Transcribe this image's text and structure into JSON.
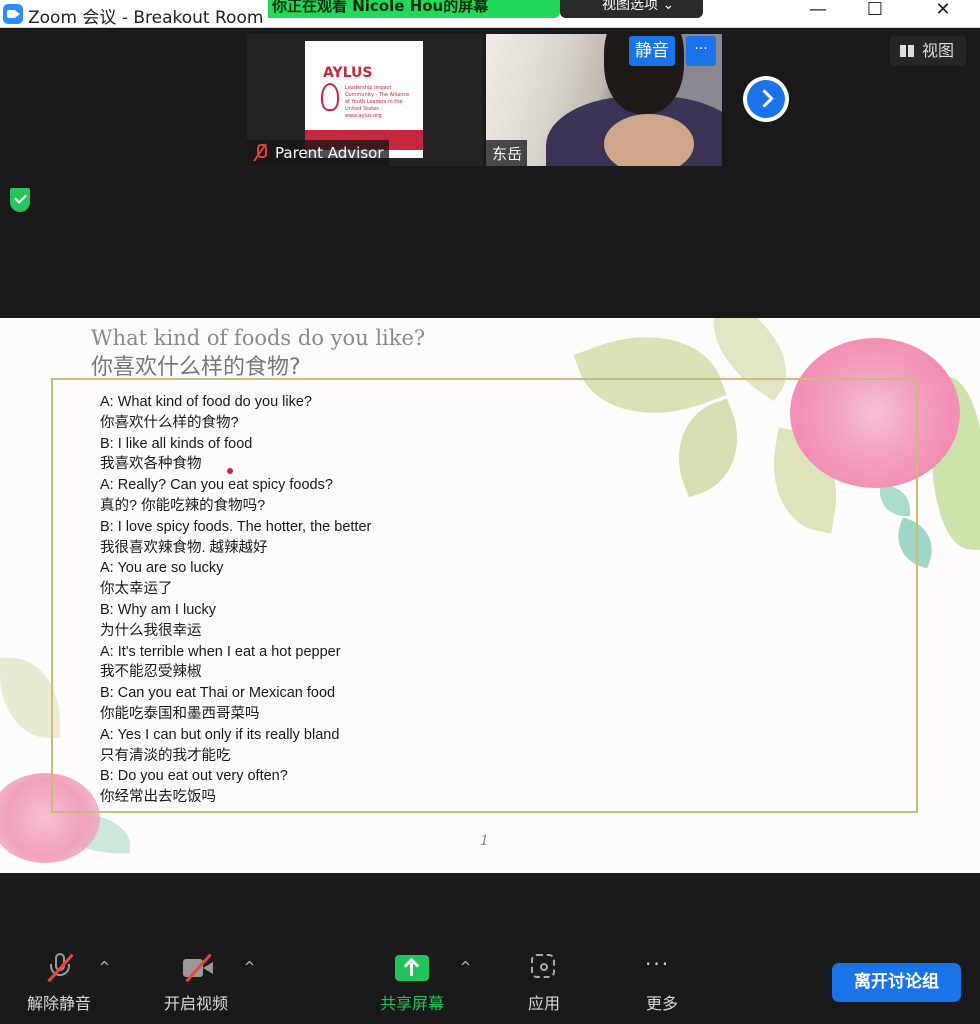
{
  "window": {
    "title": "Zoom 会议 - Breakout Room",
    "share_banner": "你正在观看 Nicole Hou的屏幕",
    "view_options": "视图选项",
    "minimize": "—",
    "maximize": "☐",
    "close": "✕"
  },
  "participants": [
    {
      "name": "Parent Advisor",
      "muted": true,
      "slide_heading": "AYLUS",
      "slide_caption": "Leadership Impact Community · The Alliance of Youth Leaders in the United States · www.aylus.org"
    },
    {
      "name": "东岳",
      "muted": false,
      "mute_action": "静音",
      "more_label": "···"
    }
  ],
  "view_button": {
    "label": "视图"
  },
  "slide": {
    "title_en": "What kind of foods do you like?",
    "title_zh": "你喜欢什么样的食物?",
    "page_number": "1",
    "dialog": [
      "A: What kind of food do you like?",
      "你喜欢什么样的食物?",
      "B: I like all kinds of food",
      "我喜欢各种食物",
      "A: Really? Can you eat spicy foods?",
      "真的? 你能吃辣的食物吗?",
      "B: I love spicy foods. The hotter, the better",
      "我很喜欢辣食物. 越辣越好",
      "A: You are so lucky",
      "你太幸运了",
      "B: Why am I lucky",
      "为什么我很幸运",
      "A: It's terrible when I eat a hot pepper",
      "我不能忍受辣椒",
      "B: Can you eat Thai or Mexican food",
      "你能吃泰国和墨西哥菜吗",
      "A: Yes I can but only if its really bland",
      "只有清淡的我才能吃",
      "B: Do you eat out very often?",
      "你经常出去吃饭吗"
    ]
  },
  "toolbar": {
    "unmute": "解除静音",
    "start_video": "开启视频",
    "share_screen": "共享屏幕",
    "apps": "应用",
    "more": "更多",
    "leave": "离开讨论组",
    "caret": "^",
    "more_dots": "···",
    "share_color": "#21c35c",
    "accent_color": "#1a73e8"
  }
}
